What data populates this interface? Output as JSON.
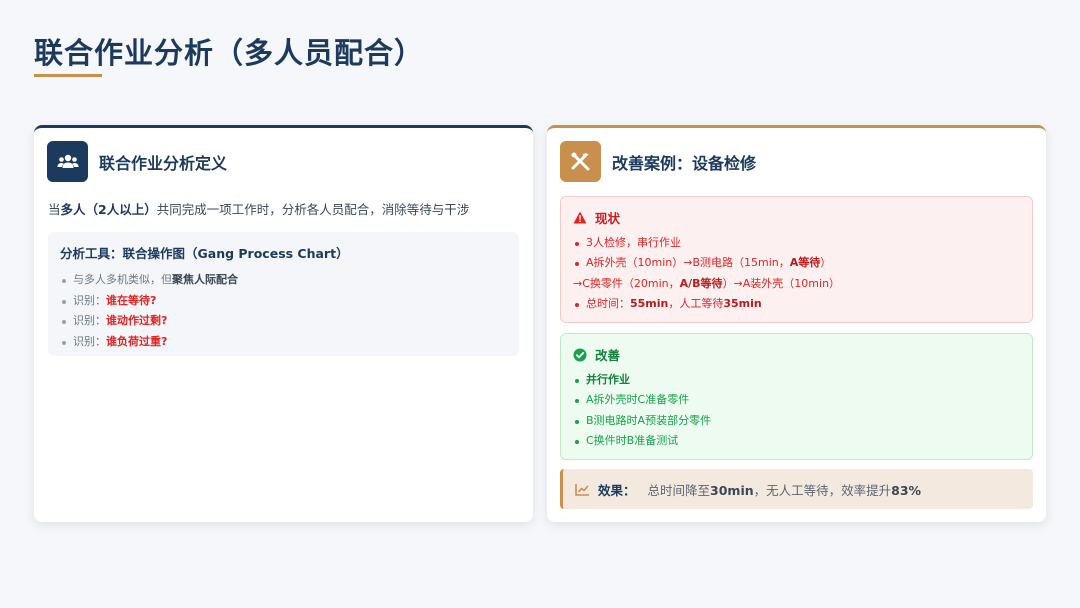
{
  "page": {
    "title": "联合作业分析（多人员配合）"
  },
  "left_card": {
    "title": "联合作业分析定义",
    "icon": "users-icon",
    "definition": {
      "prefix": "当",
      "bold": "多人（2人以上）",
      "suffix": "共同完成一项工作时，分析各人员配合，消除等待与干涉"
    },
    "tool": {
      "title": "分析工具：联合操作图（Gang Process Chart）",
      "items": [
        {
          "text": "与多人多机类似，但",
          "bold": "聚焦人际配合"
        },
        {
          "text": "识别：",
          "highlight": "谁在等待?"
        },
        {
          "text": "识别：",
          "highlight": "谁动作过剩?"
        },
        {
          "text": "识别：",
          "highlight": "谁负荷过重?"
        }
      ]
    }
  },
  "right_card": {
    "title": "改善案例：设备检修",
    "icon": "tools-icon",
    "current": {
      "label": "现状",
      "icon": "warning-icon",
      "items": [
        {
          "a": "3人检修，串行作业"
        },
        {
          "a": "A拆外壳（10min）→B测电路（15min，",
          "b": "A等待",
          "c": "）"
        },
        {
          "a": "→C换零件（20min，",
          "b": "A/B等待",
          "c": "）→A装外壳（10min）"
        },
        {
          "a": "总时间：",
          "b": "55min",
          "c": "，人工等待",
          "d": "35min"
        }
      ]
    },
    "improve": {
      "label": "改善",
      "icon": "check-circle-icon",
      "items": [
        {
          "bold": "并行作业"
        },
        {
          "text": "A拆外壳时C准备零件"
        },
        {
          "text": "B测电路时A预装部分零件"
        },
        {
          "text": "C换件时B准备测试"
        }
      ]
    },
    "effect": {
      "label": "效果：",
      "icon": "trend-icon",
      "prefix": "总时间降至",
      "b1": "30min",
      "middle": "，无人工等待，效率提升",
      "b2": "83%"
    }
  },
  "colors": {
    "navy": "#1c3a5e",
    "accent": "#c98f4d",
    "red": "#dc2626",
    "green": "#16a34a"
  }
}
